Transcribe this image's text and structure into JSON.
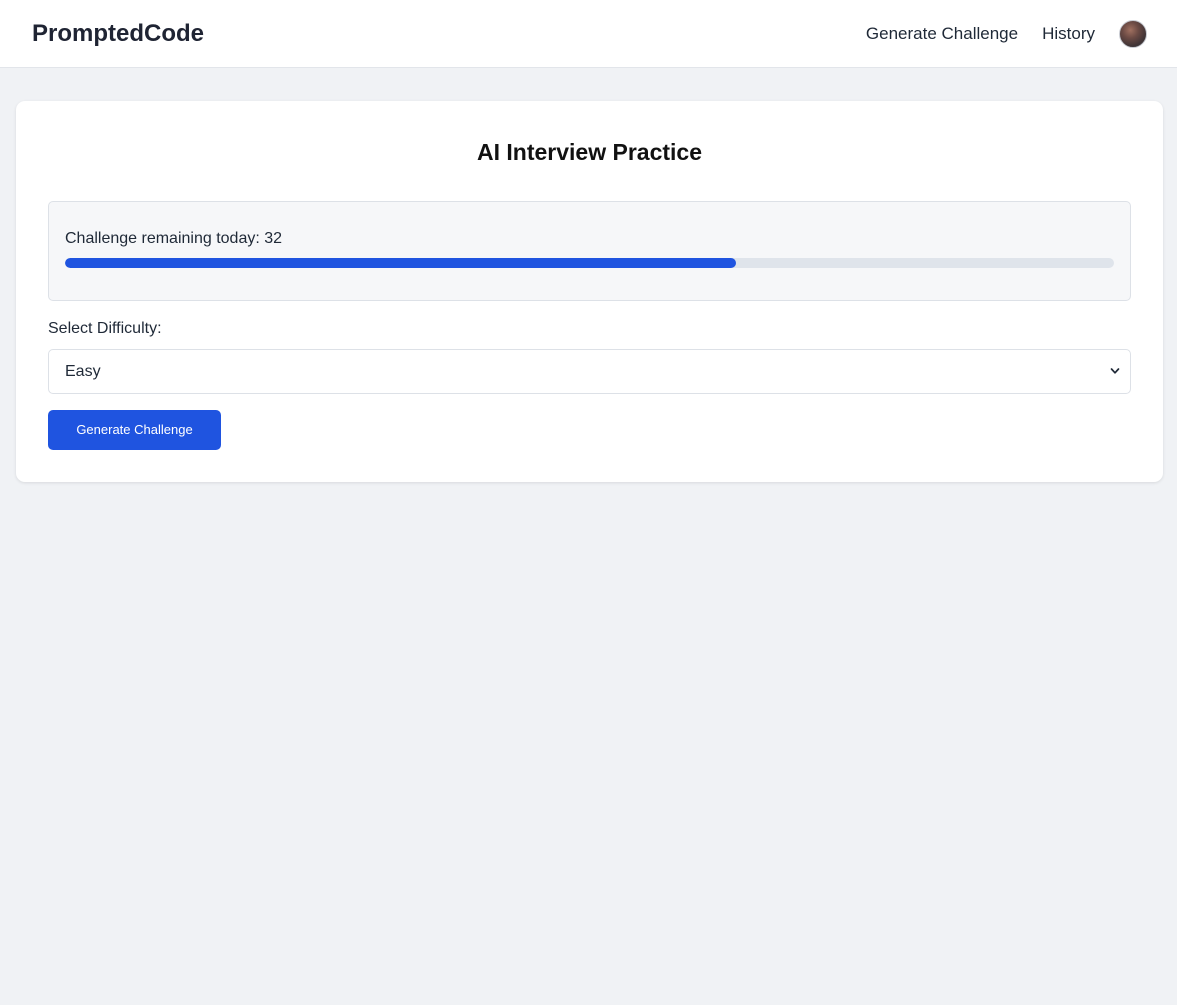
{
  "navbar": {
    "brand": "PromptedCode",
    "links": [
      "Generate Challenge",
      "History"
    ]
  },
  "card": {
    "title": "AI Interview Practice",
    "quota": {
      "text": "Challenge remaining today: 32",
      "progress_percent": 64
    },
    "difficulty": {
      "label": "Select Difficulty:",
      "selected": "Easy"
    },
    "generate_button": "Generate Challenge"
  },
  "colors": {
    "accent": "#1f54e0",
    "page_background": "#f0f2f5",
    "progress_track": "#dfe4eb"
  },
  "icons": {
    "select": "chevron-down-icon",
    "avatar": "user-avatar"
  }
}
